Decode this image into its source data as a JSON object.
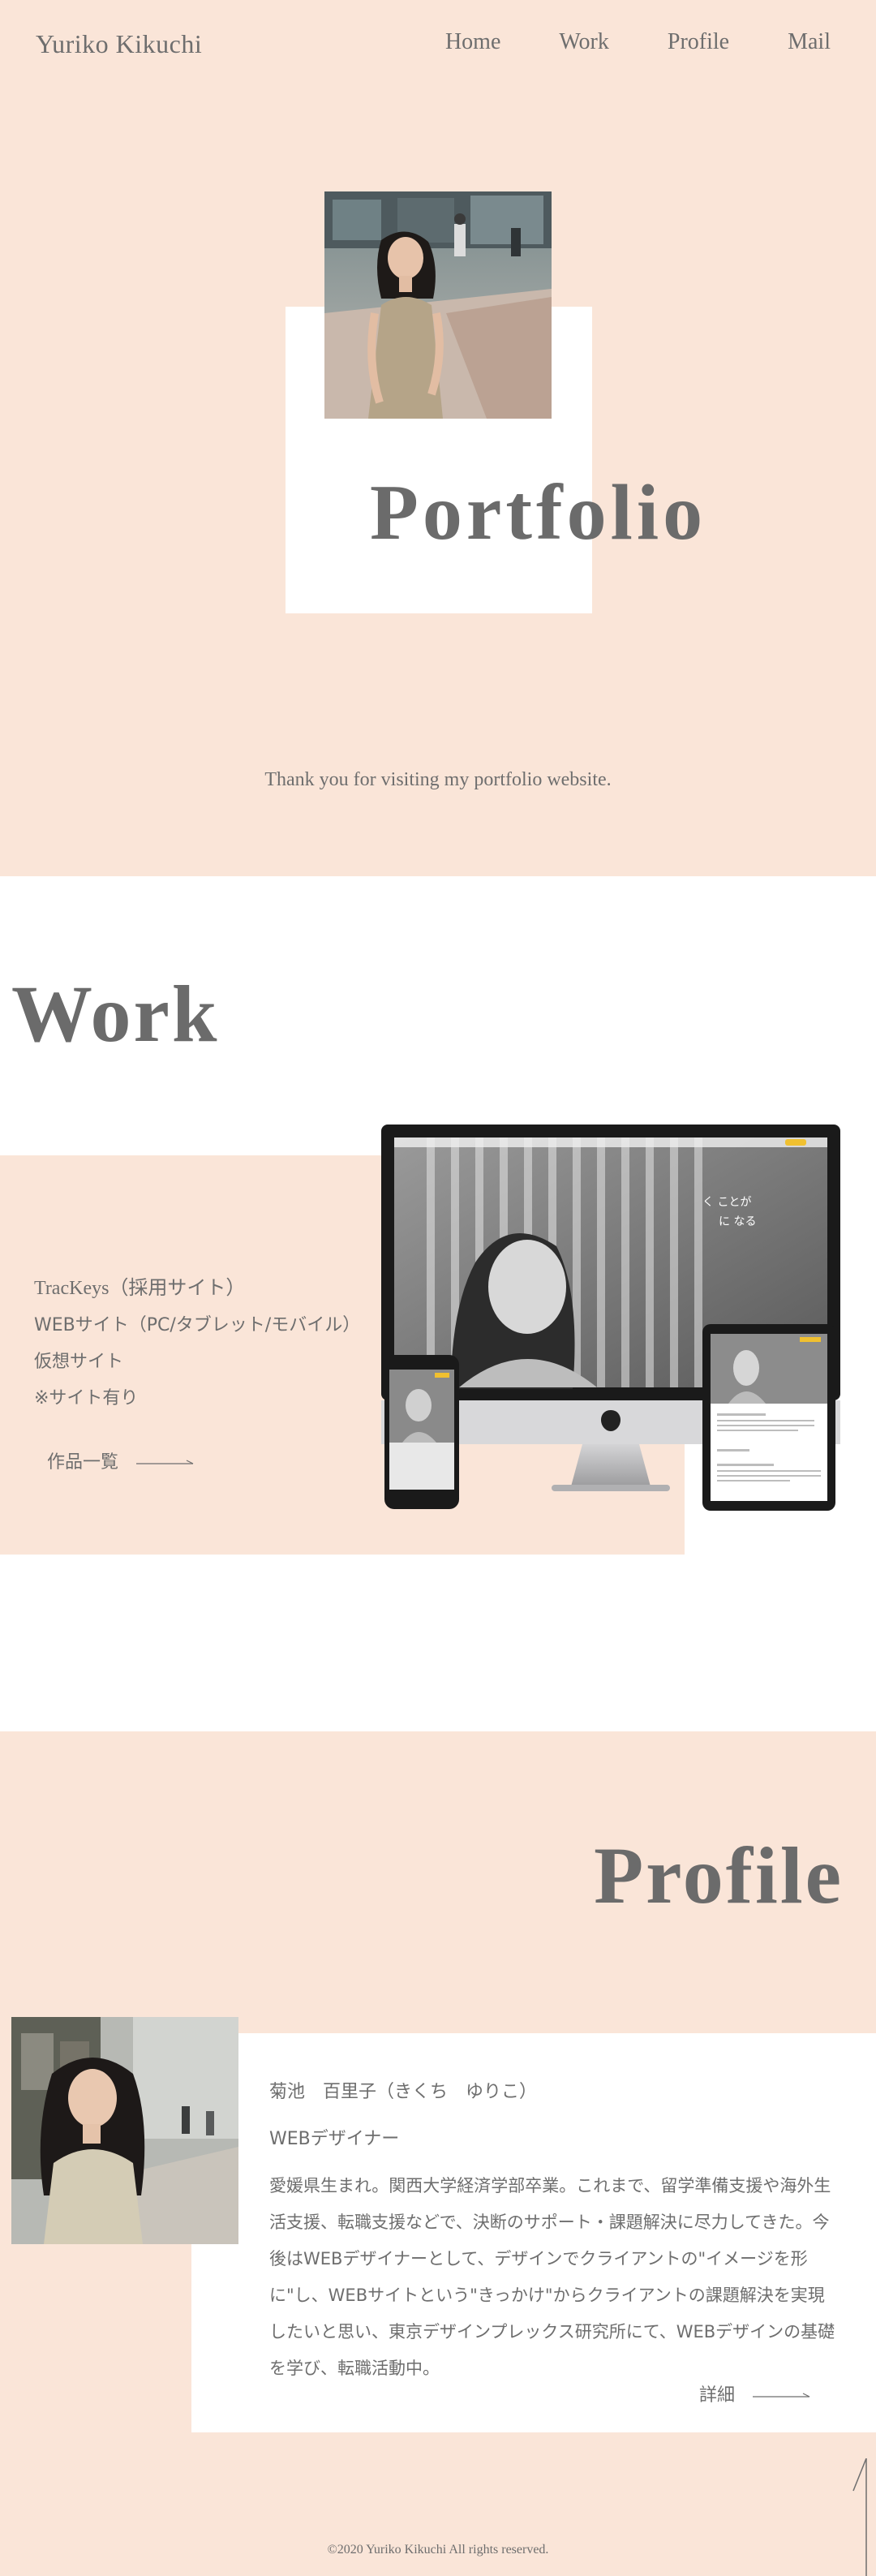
{
  "header": {
    "logo": "Yuriko Kikuchi",
    "nav": [
      {
        "label": "Home"
      },
      {
        "label": "Work"
      },
      {
        "label": "Profile"
      },
      {
        "label": "Mail"
      }
    ]
  },
  "hero": {
    "title": "Portfolio",
    "subtitle": "Thank you for visiting my portfolio website."
  },
  "work": {
    "title": "Work",
    "items": [
      "TracKeys（採用サイト）",
      "WEBサイト（PC/タブレット/モバイル）",
      "仮想サイト",
      "※サイト有り"
    ],
    "more_label": "作品一覧",
    "screen_text": [
      "く ことが",
      "に なる"
    ]
  },
  "profile": {
    "title": "Profile",
    "name": "菊池　百里子（きくち　ゆりこ）",
    "role": "WEBデザイナー",
    "bio": "愛媛県生まれ。関西大学経済学部卒業。これまで、留学準備支援や海外生活支援、転職支援などで、決断のサポート・課題解決に尽力してきた。今後はWEBデザイナーとして、デザインでクライアントの\"イメージを形に\"し、WEBサイトという\"きっかけ\"からクライアントの課題解決を実現したいと思い、東京デザインプレックス研究所にて、WEBデザインの基礎を学び、転職活動中。",
    "detail_label": "詳細"
  },
  "footer": {
    "copyright": "©2020 Yuriko Kikuchi All rights reserved."
  },
  "colors": {
    "peach": "#fae5d8",
    "text": "#6e6e6e",
    "white": "#ffffff"
  }
}
